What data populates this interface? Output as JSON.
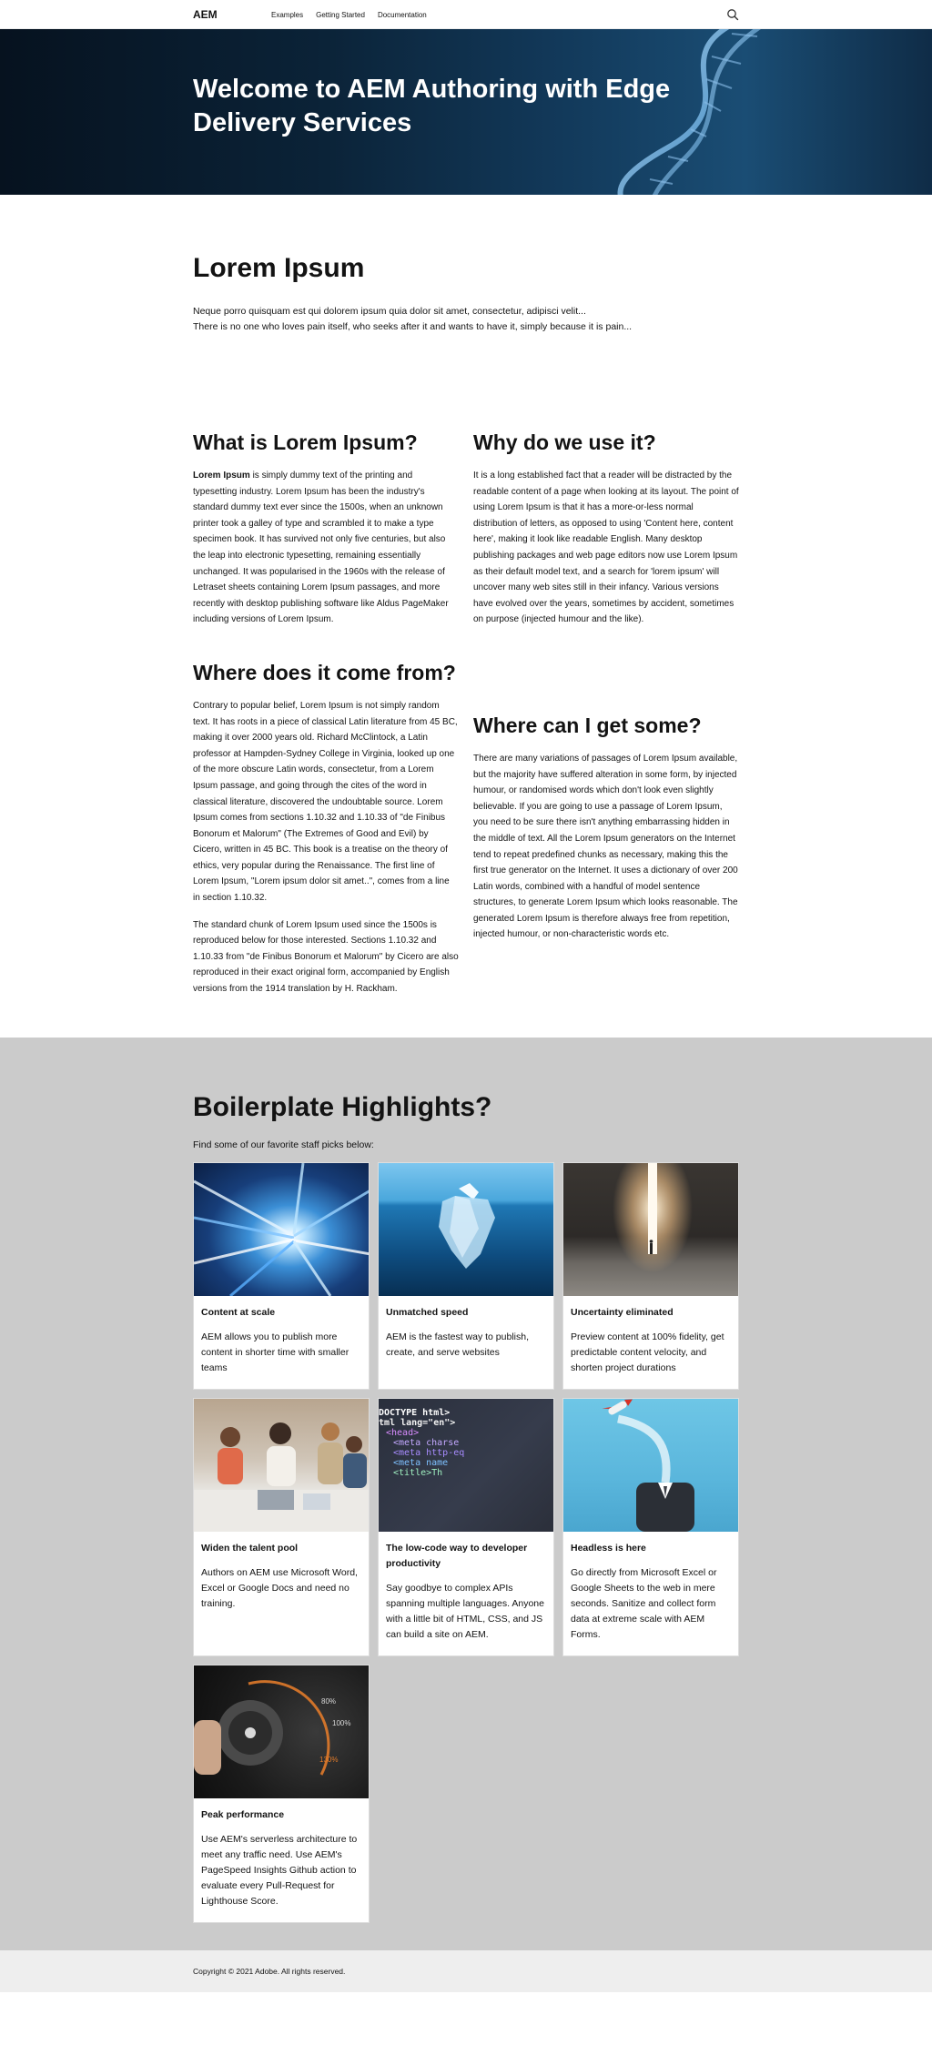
{
  "header": {
    "logo": "AEM",
    "nav": [
      "Examples",
      "Getting Started",
      "Documentation"
    ]
  },
  "hero": {
    "title": "Welcome to AEM Authoring with Edge Delivery Services"
  },
  "intro": {
    "title": "Lorem Ipsum",
    "line1": "Neque porro quisquam est qui dolorem ipsum quia dolor sit amet, consectetur, adipisci velit...",
    "line2": "There is no one who loves pain itself, who seeks after it and wants to have it, simply because it is pain..."
  },
  "what": {
    "title": "What is Lorem Ipsum?",
    "bold": "Lorem Ipsum",
    "text": " is simply dummy text of the printing and typesetting industry. Lorem Ipsum has been the industry's standard dummy text ever since the 1500s, when an unknown printer took a galley of type and scrambled it to make a type specimen book. It has survived not only five centuries, but also the leap into electronic typesetting, remaining essentially unchanged. It was popularised in the 1960s with the release of Letraset sheets containing Lorem Ipsum passages, and more recently with desktop publishing software like Aldus PageMaker including versions of Lorem Ipsum."
  },
  "why": {
    "title": "Why do we use it?",
    "text": "It is a long established fact that a reader will be distracted by the readable content of a page when looking at its layout. The point of using Lorem Ipsum is that it has a more-or-less normal distribution of letters, as opposed to using 'Content here, content here', making it look like readable English. Many desktop publishing packages and web page editors now use Lorem Ipsum as their default model text, and a search for 'lorem ipsum' will uncover many web sites still in their infancy. Various versions have evolved over the years, sometimes by accident, sometimes on purpose (injected humour and the like)."
  },
  "where_from": {
    "title": "Where does it come from?",
    "p1": "Contrary to popular belief, Lorem Ipsum is not simply random text. It has roots in a piece of classical Latin literature from 45 BC, making it over 2000 years old. Richard McClintock, a Latin professor at Hampden-Sydney College in Virginia, looked up one of the more obscure Latin words, consectetur, from a Lorem Ipsum passage, and going through the cites of the word in classical literature, discovered the undoubtable source. Lorem Ipsum comes from sections 1.10.32 and 1.10.33 of \"de Finibus Bonorum et Malorum\" (The Extremes of Good and Evil) by Cicero, written in 45 BC. This book is a treatise on the theory of ethics, very popular during the Renaissance. The first line of Lorem Ipsum, \"Lorem ipsum dolor sit amet..\", comes from a line in section 1.10.32.",
    "p2": "The standard chunk of Lorem Ipsum used since the 1500s is reproduced below for those interested. Sections 1.10.32 and 1.10.33 from \"de Finibus Bonorum et Malorum\" by Cicero are also reproduced in their exact original form, accompanied by English versions from the 1914 translation by H. Rackham."
  },
  "where_get": {
    "title": "Where can I get some?",
    "text": "There are many variations of passages of Lorem Ipsum available, but the majority have suffered alteration in some form, by injected humour, or randomised words which don't look even slightly believable. If you are going to use a passage of Lorem Ipsum, you need to be sure there isn't anything embarrassing hidden in the middle of text. All the Lorem Ipsum generators on the Internet tend to repeat predefined chunks as necessary, making this the first true generator on the Internet. It uses a dictionary of over 200 Latin words, combined with a handful of model sentence structures, to generate Lorem Ipsum which looks reasonable. The generated Lorem Ipsum is therefore always free from repetition, injected humour, or non-characteristic words etc."
  },
  "highlights": {
    "title": "Boilerplate Highlights?",
    "subtitle": "Find some of our favorite staff picks below:",
    "cards": [
      {
        "title": "Content at scale",
        "text": "AEM allows you to publish more content in shorter time with smaller teams",
        "image": "speed-tunnel"
      },
      {
        "title": "Unmatched speed",
        "text": "AEM is the fastest way to publish, create, and serve websites",
        "image": "iceberg"
      },
      {
        "title": "Uncertainty eliminated",
        "text": "Preview content at 100% fidelity, get predictable content velocity, and shorten project durations",
        "image": "light-door"
      },
      {
        "title": "Widen the talent pool",
        "text": "Authors on AEM use Microsoft Word, Excel or Google Docs and need no training.",
        "image": "team-meeting"
      },
      {
        "title": "The low-code way to developer productivity",
        "text": "Say goodbye to complex APIs spanning multiple languages. Anyone with a little bit of HTML, CSS, and JS can build a site on AEM.",
        "image": "html-code"
      },
      {
        "title": "Headless is here",
        "text": "Go directly from Microsoft Excel or Google Sheets to the web in mere seconds. Sanitize and collect form data at extreme scale with AEM Forms.",
        "image": "rocket-head"
      },
      {
        "title": "Peak performance",
        "text": "Use AEM's serverless architecture to meet any traffic need. Use AEM's PageSpeed Insights Github action to evaluate every Pull-Request for Lighthouse Score.",
        "image": "speed-dial"
      }
    ],
    "code_lines": [
      "DOCTYPE html>",
      "tml lang=\"en\">",
      "<head>",
      "<meta charse",
      "<meta http-eq",
      "<meta name",
      "<title>Th"
    ],
    "dial_labels": [
      "80%",
      "100%",
      "130%"
    ]
  },
  "footer": {
    "copyright": "Copyright © 2021 Adobe. All rights reserved."
  }
}
